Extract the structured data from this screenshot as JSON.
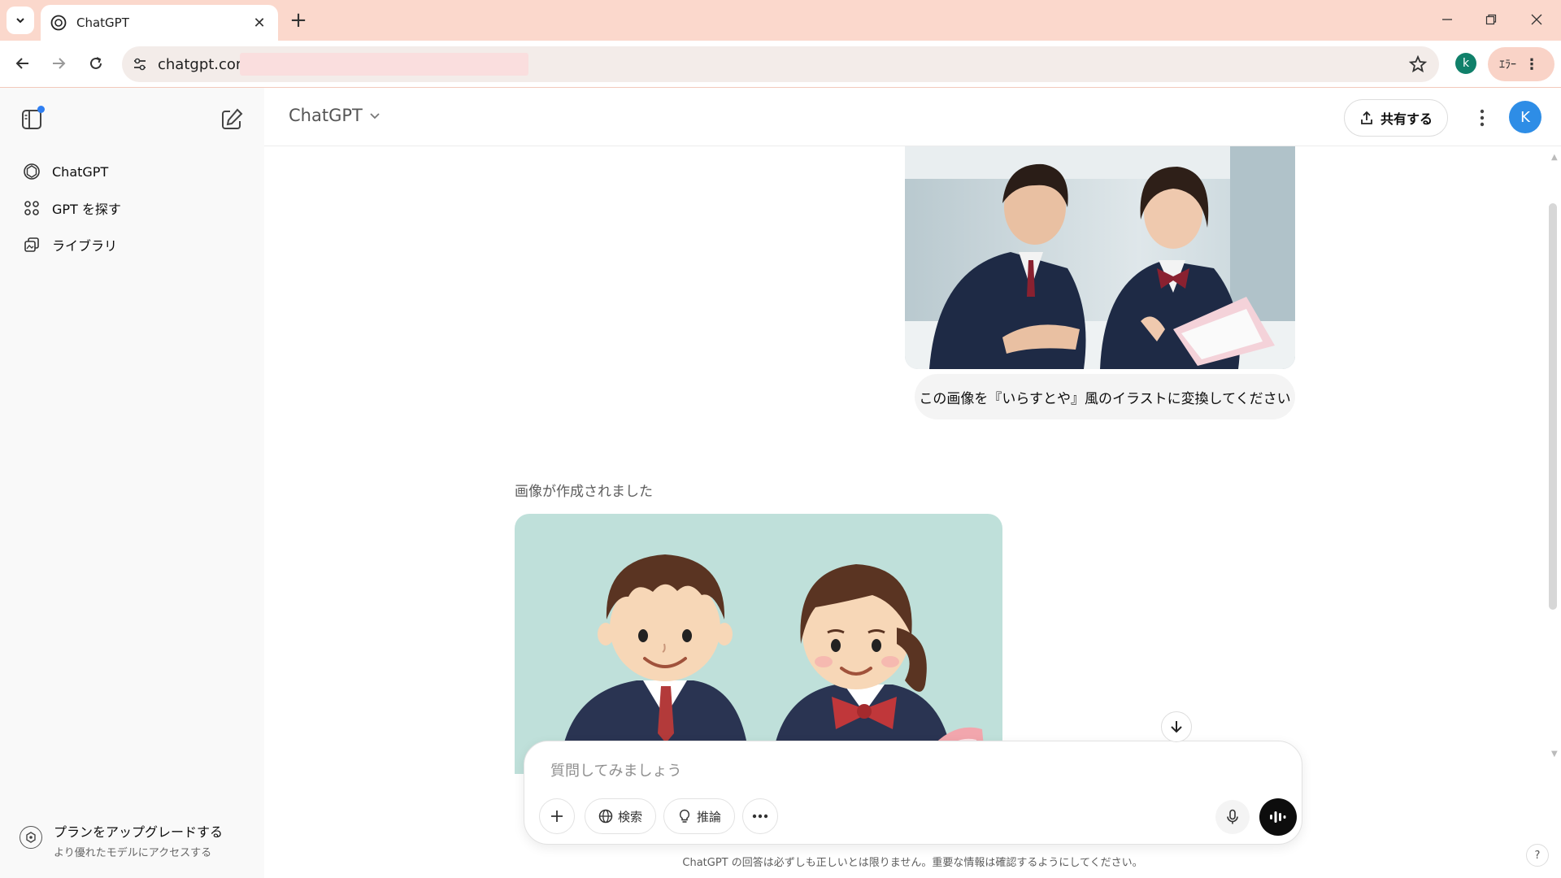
{
  "browser": {
    "tab_title": "ChatGPT",
    "url": "chatgpt.com/",
    "profile_initial": "k",
    "error_chip_label": "ｴﾗｰ"
  },
  "sidebar": {
    "items": [
      {
        "label": "ChatGPT",
        "icon": "openai-logo-icon"
      },
      {
        "label": "GPT を探す",
        "icon": "grid-dots-icon"
      },
      {
        "label": "ライブラリ",
        "icon": "library-icon"
      }
    ],
    "upgrade": {
      "title": "プランをアップグレードする",
      "subtitle": "より優れたモデルにアクセスする"
    }
  },
  "header": {
    "model_name": "ChatGPT",
    "share_label": "共有する",
    "avatar_initial": "K"
  },
  "conversation": {
    "user_message": "この画像を『いらすとや』風のイラストに変換してください",
    "assistant_status": "画像が作成されました"
  },
  "composer": {
    "placeholder": "質問してみましょう",
    "search_label": "検索",
    "reason_label": "推論"
  },
  "disclaimer": "ChatGPT の回答は必ずしも正しいとは限りません。重要な情報は確認するようにしてください。",
  "help_label": "?",
  "colors": {
    "tabbar_bg": "#fbd8cc",
    "sidebar_bg": "#f9f9f9",
    "avatar_blue": "#2e8de6",
    "profile_green": "#10806a",
    "illust_bg": "#bfe0da"
  }
}
